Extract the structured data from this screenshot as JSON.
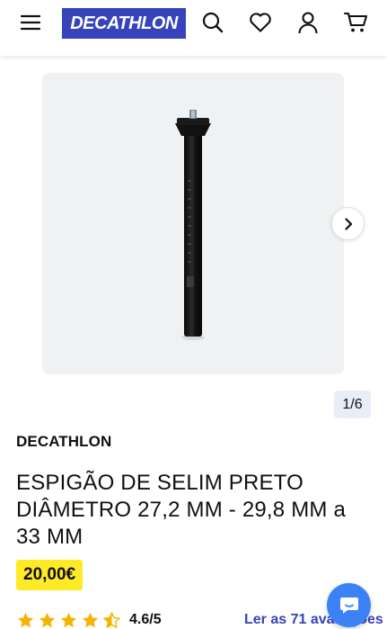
{
  "header": {
    "logo_text": "DECATHLON",
    "brand_color": "#3643ba",
    "icons": [
      "menu-icon",
      "search-icon",
      "heart-icon",
      "user-icon",
      "cart-icon"
    ]
  },
  "gallery": {
    "counter": "1/6",
    "next_icon": "chevron-right-icon"
  },
  "product": {
    "brand": "DECATHLON",
    "title": "ESPIGÃO DE SELIM PRETO DIÂMETRO 27,2 MM - 29,8 MM a 33 MM",
    "price": "20,00€",
    "price_bg": "#ffea28"
  },
  "rating": {
    "stars": 4.5,
    "score": "4.6/5",
    "star_color": "#f5b301",
    "reviews_link": "Ler as 71 avaliações"
  },
  "chat": {
    "icon": "chat-icon",
    "color": "#3b82f6"
  }
}
